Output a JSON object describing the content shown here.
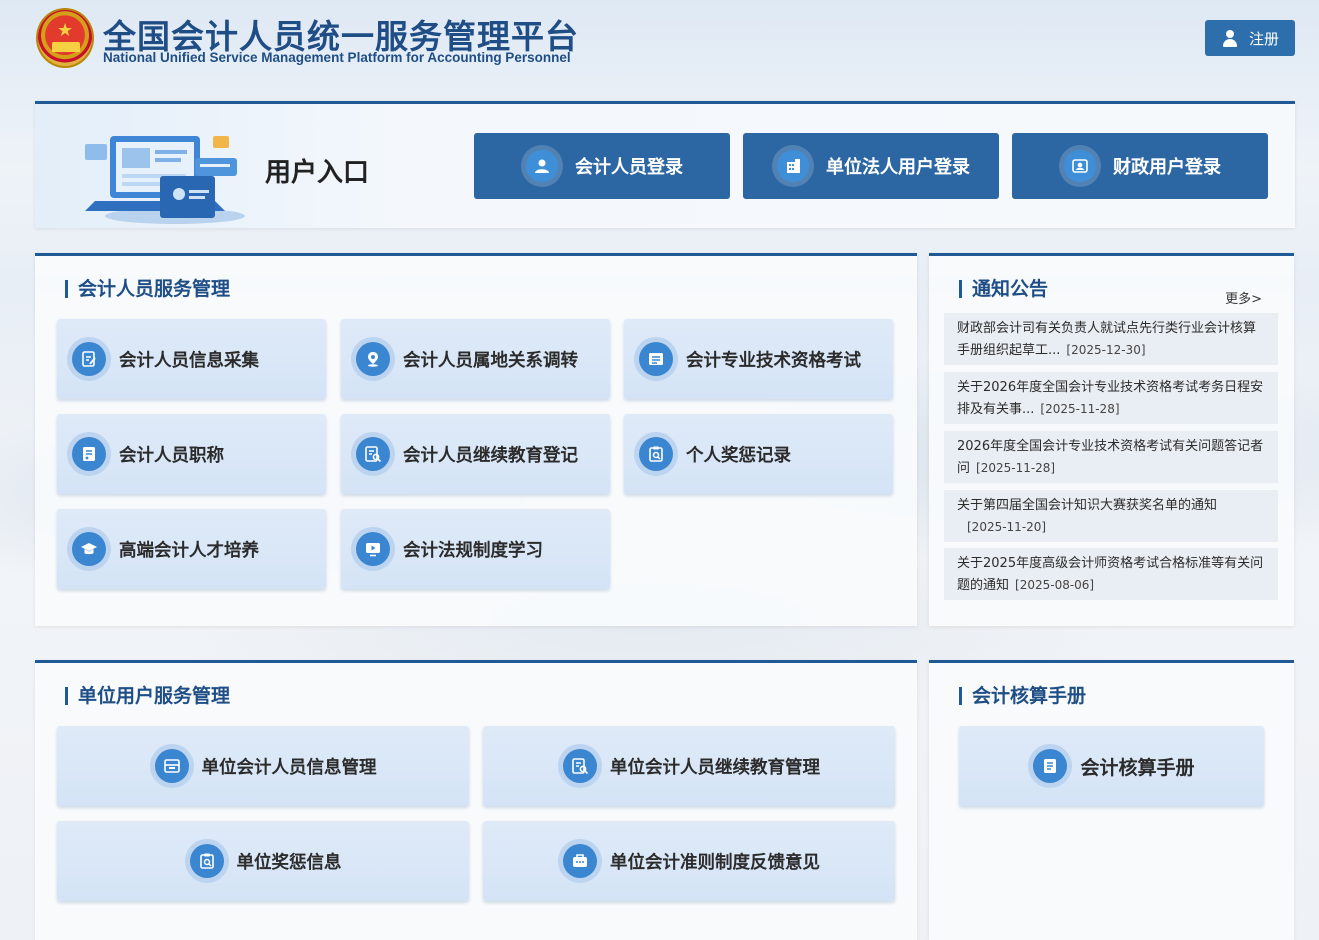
{
  "header": {
    "title": "全国会计人员统一服务管理平台",
    "subtitle": "National Unified Service Management Platform for Accounting Personnel",
    "register_label": "注册"
  },
  "entry": {
    "title": "用户入口",
    "buttons": [
      {
        "label": "会计人员登录",
        "icon": "user-icon"
      },
      {
        "label": "单位法人用户登录",
        "icon": "building-icon"
      },
      {
        "label": "财政用户登录",
        "icon": "id-card-icon"
      }
    ]
  },
  "personnel": {
    "title": "会计人员服务管理",
    "tiles": [
      {
        "label": "会计人员信息采集",
        "icon": "edit-form-icon"
      },
      {
        "label": "会计人员属地关系调转",
        "icon": "location-icon"
      },
      {
        "label": "会计专业技术资格考试",
        "icon": "exam-icon"
      },
      {
        "label": "会计人员职称",
        "icon": "document-icon"
      },
      {
        "label": "会计人员继续教育登记",
        "icon": "search-document-icon"
      },
      {
        "label": "个人奖惩记录",
        "icon": "clipboard-search-icon"
      },
      {
        "label": "高端会计人才培养",
        "icon": "graduation-cap-icon"
      },
      {
        "label": "会计法规制度学习",
        "icon": "play-icon"
      }
    ]
  },
  "notice": {
    "title": "通知公告",
    "more_label": "更多>",
    "items": [
      {
        "text": "财政部会计司有关负责人就试点先行类行业会计核算手册组织起草工...",
        "date": "[2025-12-30]"
      },
      {
        "text": "关于2026年度全国会计专业技术资格考试考务日程安排及有关事...",
        "date": "[2025-11-28]"
      },
      {
        "text": "2026年度全国会计专业技术资格考试有关问题答记者问",
        "date": "[2025-11-28]"
      },
      {
        "text": "关于第四届全国会计知识大赛获奖名单的通知",
        "date": "[2025-11-20]"
      },
      {
        "text": "关于2025年度高级会计师资格考试合格标准等有关问题的通知",
        "date": "[2025-08-06]"
      }
    ]
  },
  "unit": {
    "title": "单位用户服务管理",
    "tiles": [
      {
        "label": "单位会计人员信息管理",
        "icon": "inbox-icon"
      },
      {
        "label": "单位会计人员继续教育管理",
        "icon": "search-document-icon"
      },
      {
        "label": "单位奖惩信息",
        "icon": "clipboard-search-icon"
      },
      {
        "label": "单位会计准则制度反馈意见",
        "icon": "feedback-icon"
      }
    ]
  },
  "handbook": {
    "title": "会计核算手册",
    "tile_label": "会计核算手册",
    "tile_icon": "handbook-icon"
  }
}
